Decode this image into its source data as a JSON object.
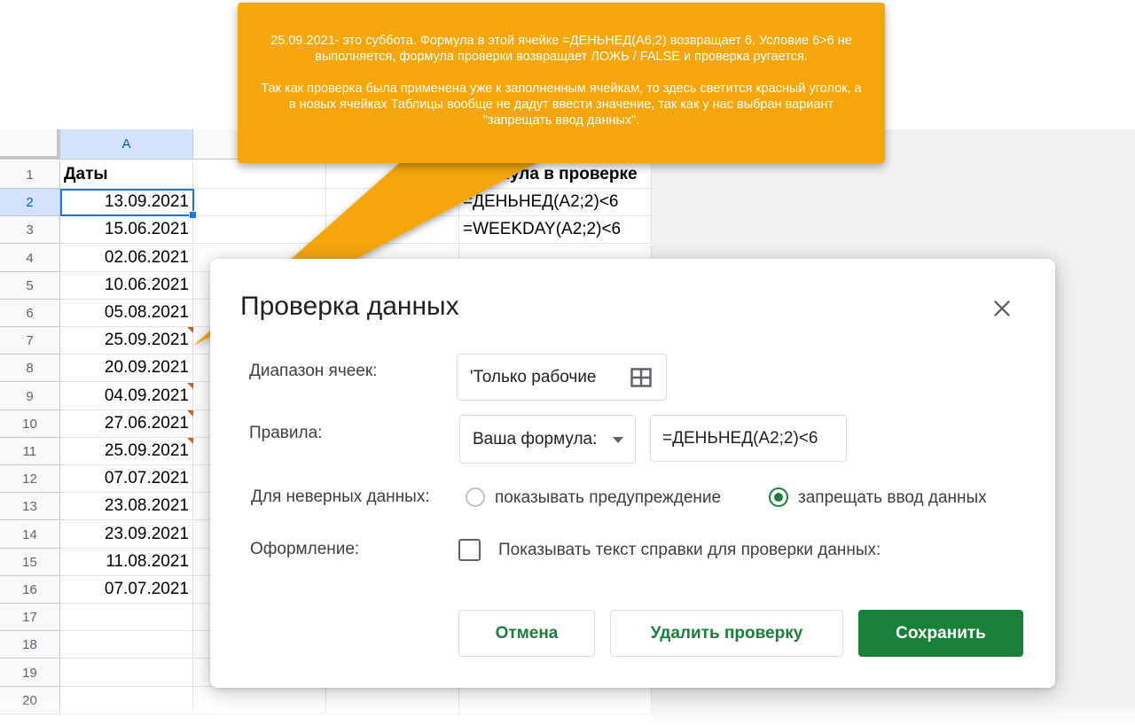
{
  "callout": {
    "line1": "25.09.2021- это суббота. Формула в этой ячейке =ДЕНЬНЕД(A6;2) возвращает 6. Условие 6>6 не выполняется, формула проверки возвращает ЛОЖЬ / FALSE и проверка ругается.",
    "line2": "Так как проверка была применена уже к заполненным ячейкам, то здесь светится красный уголок, а в новых ячейках Таблицы вообще не дадут ввести значение, так как у нас выбран вариант \"запрещать ввод данных\"."
  },
  "sheet": {
    "column_a": "A",
    "rows": [
      "1",
      "2",
      "3",
      "4",
      "5",
      "6",
      "7",
      "8",
      "9",
      "10",
      "11",
      "12",
      "13",
      "14",
      "15",
      "16",
      "17",
      "18",
      "19",
      "20"
    ],
    "header_a": "Даты",
    "header_d": "Формула в проверке",
    "dates": [
      "13.09.2021",
      "15.06.2021",
      "02.06.2021",
      "10.06.2021",
      "05.08.2021",
      "25.09.2021",
      "20.09.2021",
      "04.09.2021",
      "27.06.2021",
      "25.09.2021",
      "07.07.2021",
      "23.08.2021",
      "23.09.2021",
      "11.08.2021",
      "07.07.2021"
    ],
    "formula_ru": "=ДЕНЬНЕД(A2;2)<6",
    "formula_en": "=WEEKDAY(A2;2)<6"
  },
  "dialog": {
    "title": "Проверка данных",
    "range_label": "Диапазон ячеек:",
    "range_value": "'Только рабочие",
    "rules_label": "Правила:",
    "rule_type": "Ваша формула:",
    "rule_formula": "=ДЕНЬНЕД(A2;2)<6",
    "invalid_label": "Для неверных данных:",
    "option_warn": "показывать предупреждение",
    "option_reject": "запрещать ввод данных",
    "appearance_label": "Оформление:",
    "help_text": "Показывать текст справки для проверки данных:",
    "cancel": "Отмена",
    "remove": "Удалить проверку",
    "save": "Сохранить"
  },
  "colors": {
    "accent_green": "#188038",
    "callout_orange": "#f5a60a",
    "selection_blue": "#1a73e8",
    "error_flag": "#e8542b"
  }
}
